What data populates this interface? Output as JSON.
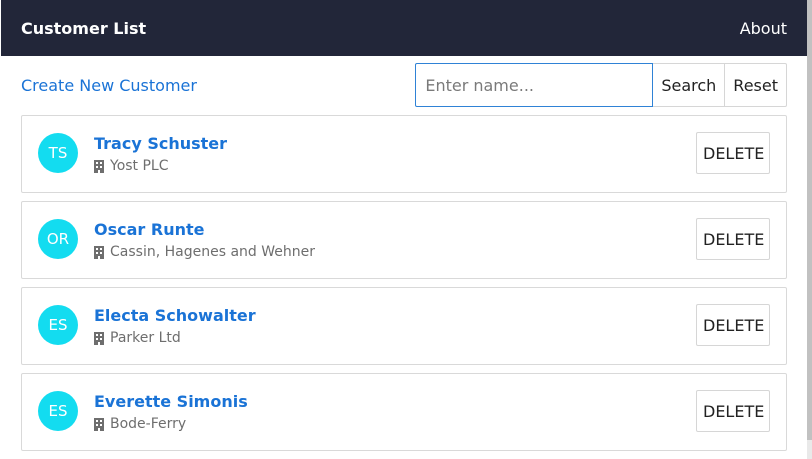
{
  "header": {
    "title": "Customer List",
    "about_label": "About"
  },
  "toolbar": {
    "create_label": "Create New Customer",
    "search_placeholder": "Enter name...",
    "search_value": "",
    "search_label": "Search",
    "reset_label": "Reset"
  },
  "customers": [
    {
      "initials": "TS",
      "name": "Tracy Schuster",
      "company": "Yost PLC",
      "delete_label": "DELETE"
    },
    {
      "initials": "OR",
      "name": "Oscar Runte",
      "company": "Cassin, Hagenes and Wehner",
      "delete_label": "DELETE"
    },
    {
      "initials": "ES",
      "name": "Electa Schowalter",
      "company": "Parker Ltd",
      "delete_label": "DELETE"
    },
    {
      "initials": "ES",
      "name": "Everette Simonis",
      "company": "Bode-Ferry",
      "delete_label": "DELETE"
    }
  ],
  "icons": {
    "company": "building-icon"
  },
  "colors": {
    "navbar": "#222639",
    "accent_link": "#1a73d6",
    "avatar": "#13dcf0"
  }
}
